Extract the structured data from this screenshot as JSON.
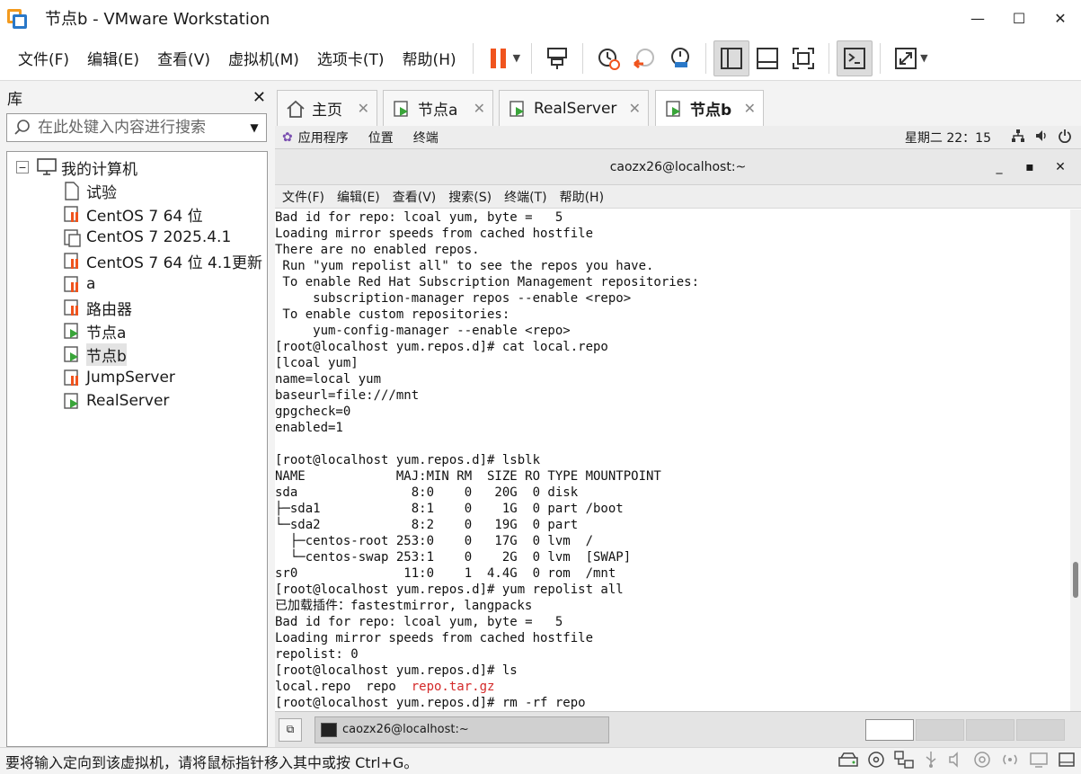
{
  "window": {
    "title": "节点b - VMware Workstation",
    "minimize": "—",
    "maximize": "☐",
    "close": "✕"
  },
  "menu": [
    "文件(F)",
    "编辑(E)",
    "查看(V)",
    "虚拟机(M)",
    "选项卡(T)",
    "帮助(H)"
  ],
  "library": {
    "title": "库",
    "close": "✕",
    "search_placeholder": "在此处键入内容进行搜索",
    "root_label": "我的计算机",
    "expander": "−",
    "items": [
      {
        "label": "试验",
        "icon": "vm-icon-plain"
      },
      {
        "label": "CentOS 7 64 位",
        "icon": "vm-icon-paused"
      },
      {
        "label": "CentOS 7 2025.4.1",
        "icon": "vm-icon-off"
      },
      {
        "label": "CentOS 7 64 位 4.1更新",
        "icon": "vm-icon-paused"
      },
      {
        "label": "a",
        "icon": "vm-icon-paused"
      },
      {
        "label": "路由器",
        "icon": "vm-icon-paused"
      },
      {
        "label": "节点a",
        "icon": "vm-icon-running"
      },
      {
        "label": "节点b",
        "icon": "vm-icon-running",
        "selected": true
      },
      {
        "label": "JumpServer",
        "icon": "vm-icon-paused"
      },
      {
        "label": "RealServer",
        "icon": "vm-icon-running"
      }
    ]
  },
  "tabs": [
    {
      "label": "主页",
      "icon": "home-icon",
      "close": "✕"
    },
    {
      "label": "节点a",
      "icon": "vm-icon-running",
      "close": "✕"
    },
    {
      "label": "RealServer",
      "icon": "vm-icon-running",
      "close": "✕"
    },
    {
      "label": "节点b",
      "icon": "vm-icon-running",
      "close": "✕",
      "active": true
    }
  ],
  "gnome": {
    "applications": "应用程序",
    "places": "位置",
    "terminal": "终端",
    "clock": "星期二 22：15"
  },
  "terminal": {
    "title": "caozx26@localhost:~",
    "min": "_",
    "max": "▪",
    "close": "✕",
    "menu": [
      "文件(F)",
      "编辑(E)",
      "查看(V)",
      "搜索(S)",
      "终端(T)",
      "帮助(H)"
    ],
    "lines": [
      "Bad id for repo: lcoal yum, byte =   5",
      "Loading mirror speeds from cached hostfile",
      "There are no enabled repos.",
      " Run \"yum repolist all\" to see the repos you have.",
      " To enable Red Hat Subscription Management repositories:",
      "     subscription-manager repos --enable <repo>",
      " To enable custom repositories:",
      "     yum-config-manager --enable <repo>",
      "[root@localhost yum.repos.d]# cat local.repo",
      "[lcoal yum]",
      "name=local yum",
      "baseurl=file:///mnt",
      "gpgcheck=0",
      "enabled=1",
      "",
      "[root@localhost yum.repos.d]# lsblk",
      "NAME            MAJ:MIN RM  SIZE RO TYPE MOUNTPOINT",
      "sda               8:0    0   20G  0 disk",
      "├─sda1            8:1    0    1G  0 part /boot",
      "└─sda2            8:2    0   19G  0 part",
      "  ├─centos-root 253:0    0   17G  0 lvm  /",
      "  └─centos-swap 253:1    0    2G  0 lvm  [SWAP]",
      "sr0              11:0    1  4.4G  0 rom  /mnt",
      "[root@localhost yum.repos.d]# yum repolist all",
      "已加载插件：fastestmirror, langpacks",
      "Bad id for repo: lcoal yum, byte =   5",
      "Loading mirror speeds from cached hostfile",
      "repolist: 0",
      "[root@localhost yum.repos.d]# ls",
      "[root@localhost yum.repos.d]# rm -rf repo"
    ],
    "ls_output": {
      "files": "local.repo  repo  ",
      "archive": "repo.tar.gz",
      "archive_color": "#d42a2a"
    }
  },
  "taskbar": {
    "task_label": "caozx26@localhost:~"
  },
  "status": {
    "message": "要将输入定向到该虚拟机，请将鼠标指针移入其中或按 Ctrl+G。"
  },
  "colors": {
    "accent_orange": "#f0541e",
    "running_green": "#3aa53a",
    "blue": "#2a78c8"
  }
}
